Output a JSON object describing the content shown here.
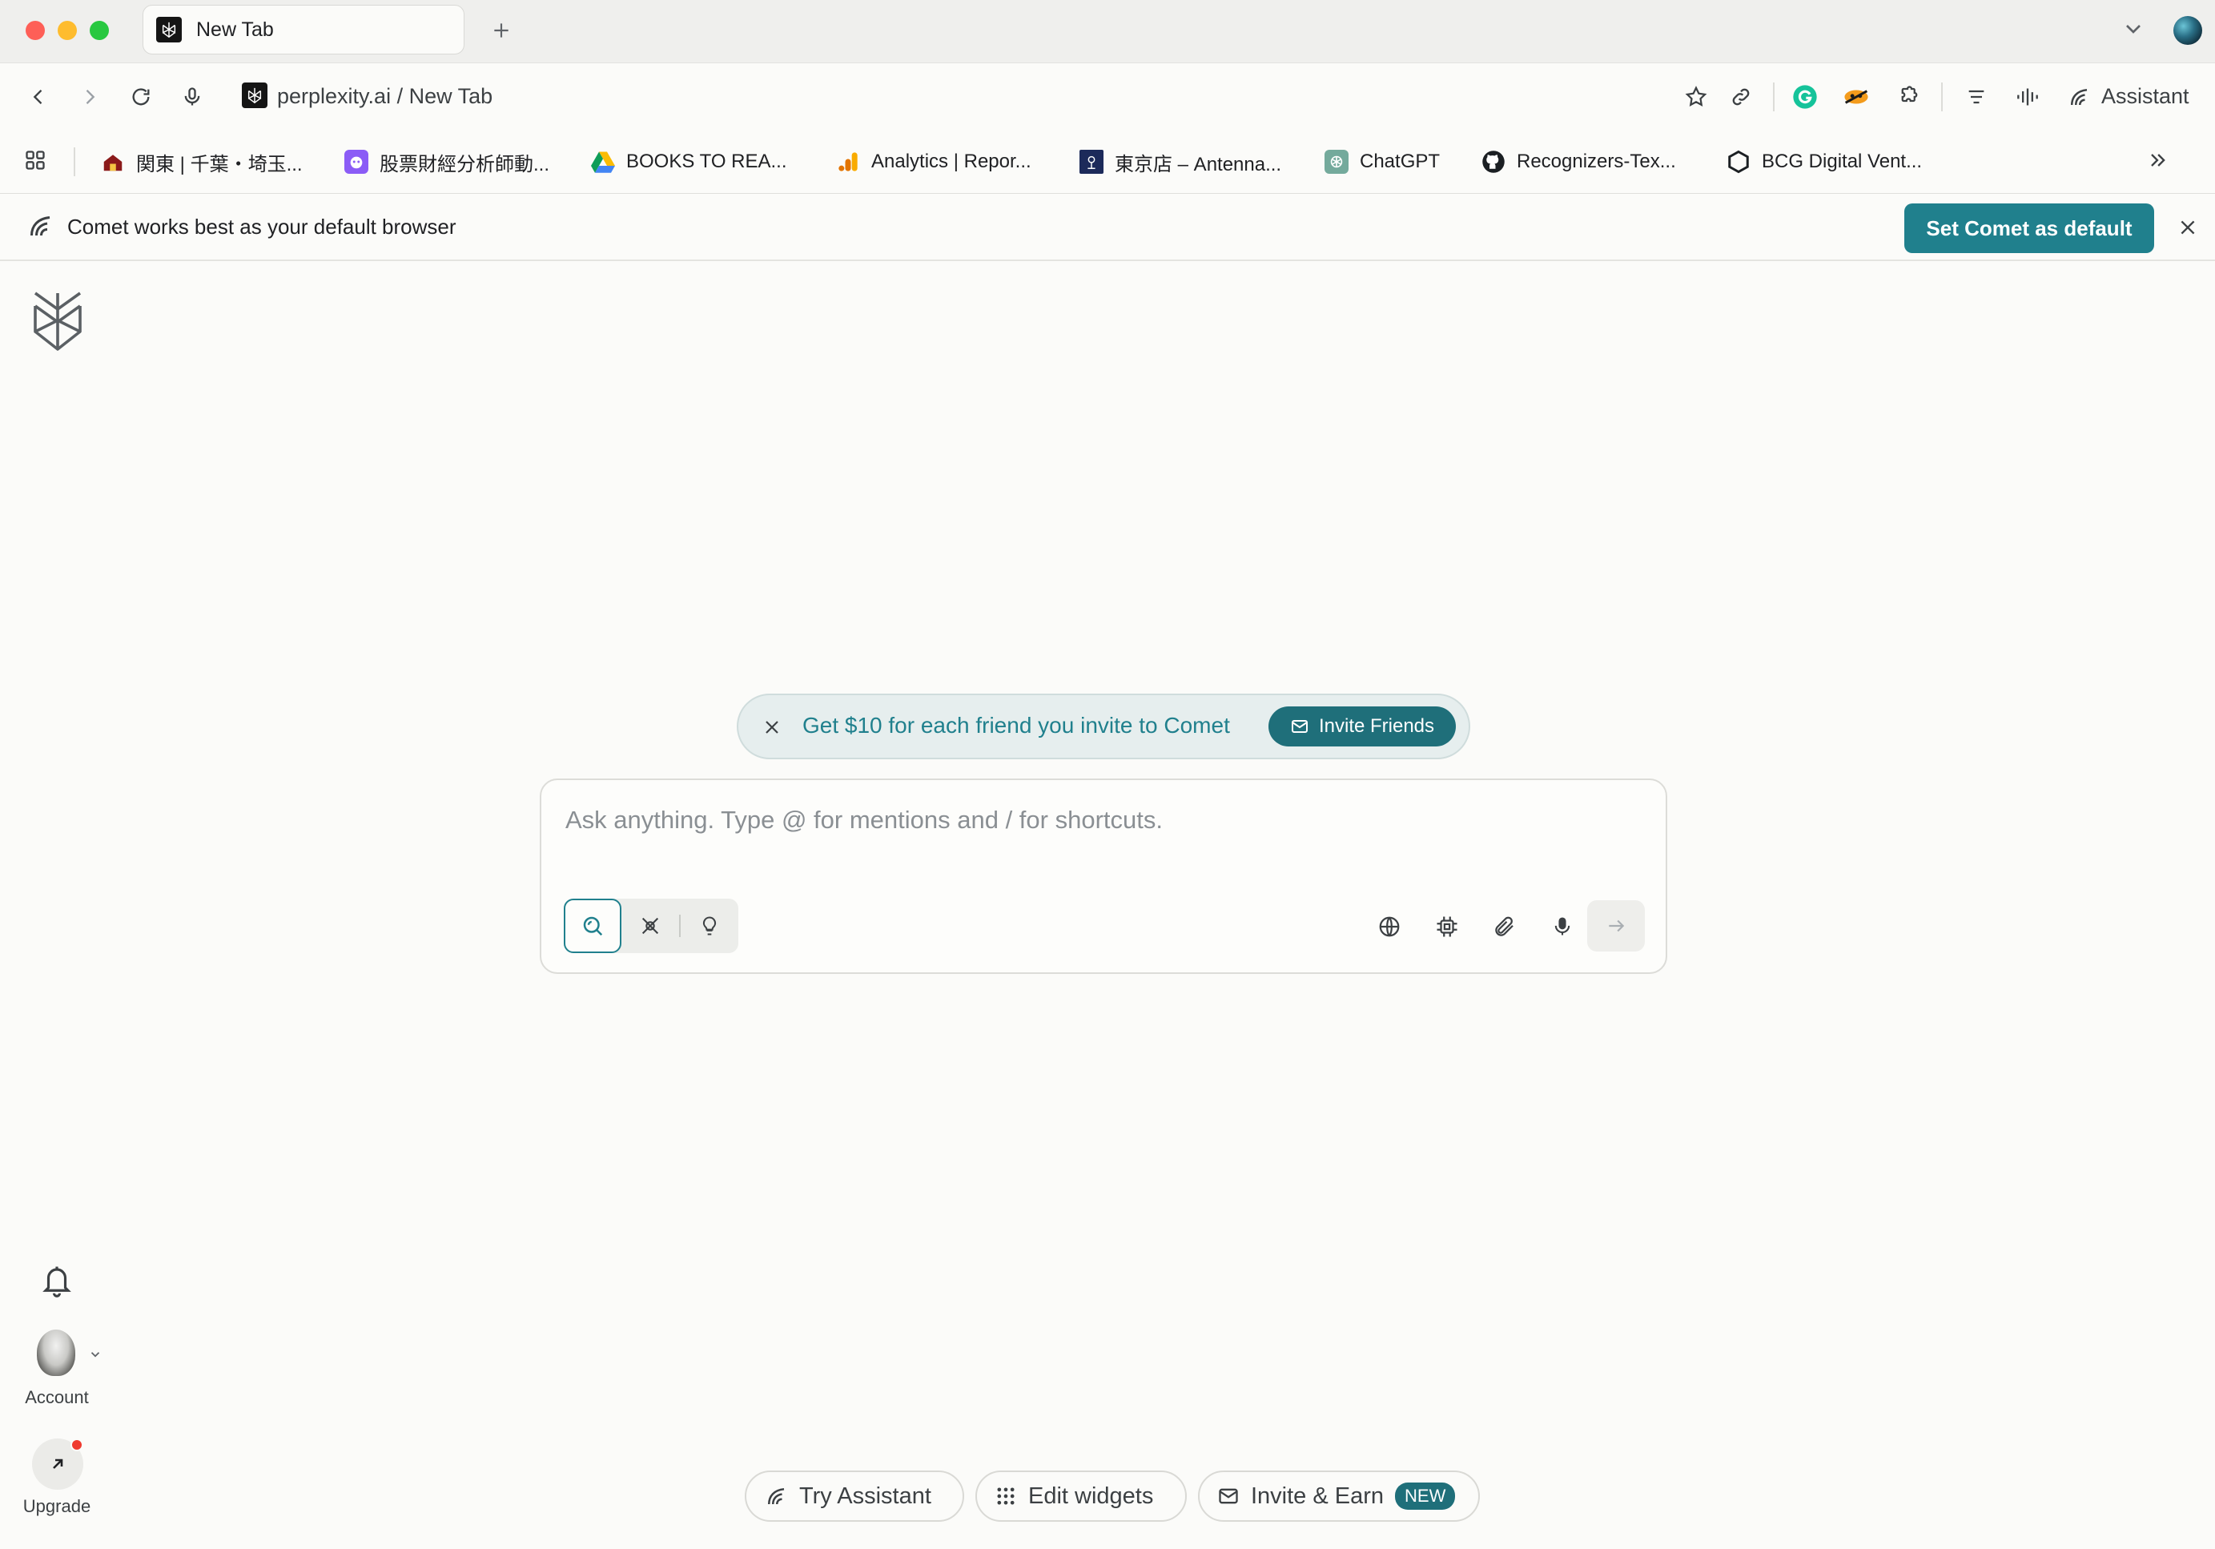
{
  "tab": {
    "title": "New Tab"
  },
  "toolbar": {
    "url": "perplexity.ai / New Tab",
    "assistant_label": "Assistant"
  },
  "bookmarks": [
    {
      "label": "関東 | 千葉・埼玉..."
    },
    {
      "label": "股票財經分析師動..."
    },
    {
      "label": "BOOKS TO REA..."
    },
    {
      "label": "Analytics | Repor..."
    },
    {
      "label": "東京店 – Antenna..."
    },
    {
      "label": "ChatGPT"
    },
    {
      "label": "Recognizers-Tex..."
    },
    {
      "label": "BCG Digital Vent..."
    }
  ],
  "banner": {
    "text": "Comet works best as your default browser",
    "button_label": "Set Comet as default"
  },
  "invite": {
    "text": "Get $10 for each friend you invite to Comet",
    "button_label": "Invite Friends"
  },
  "search": {
    "placeholder": "Ask anything. Type @ for mentions and / for shortcuts.",
    "value": ""
  },
  "sidebar": {
    "account_label": "Account",
    "upgrade_label": "Upgrade"
  },
  "bottom": {
    "try_assistant": "Try Assistant",
    "edit_widgets": "Edit widgets",
    "invite_earn": "Invite & Earn",
    "new_badge": "NEW"
  },
  "colors": {
    "accent": "#20808d",
    "accent_dark": "#1f6f7a",
    "background": "#fbfbf9",
    "notification": "#ef3a2f"
  },
  "icons": {
    "search_modes": [
      "search-icon",
      "research-icon",
      "labs-bulb-icon"
    ],
    "tools": [
      "globe-icon",
      "chip-icon",
      "paperclip-icon",
      "microphone-icon"
    ]
  }
}
